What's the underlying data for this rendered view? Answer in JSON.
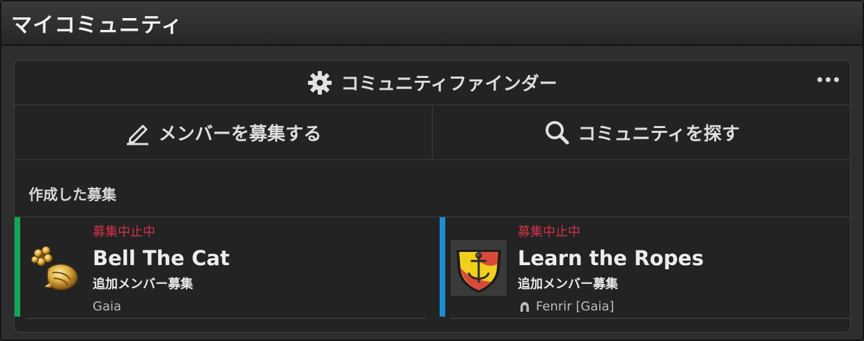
{
  "window": {
    "title": "マイコミュニティ"
  },
  "finder": {
    "title": "コミュニティファインダー"
  },
  "actions": {
    "recruit_label": "メンバーを募集する",
    "search_label": "コミュニティを探す"
  },
  "section": {
    "created_label": "作成した募集"
  },
  "cards": [
    {
      "status": "募集中止中",
      "name": "Bell The Cat",
      "subtitle": "追加メンバー募集",
      "server": "Gaia",
      "accent": "#12a85a",
      "icon": "seashell-flower-icon"
    },
    {
      "status": "募集中止中",
      "name": "Learn the Ropes",
      "subtitle": "追加メンバー募集",
      "server": "Fenrir [Gaia]",
      "server_icon": "world-visit-icon",
      "accent": "#1a8fd6",
      "icon": "anchor-crest-icon"
    }
  ],
  "colors": {
    "status_red": "#d0324a"
  }
}
